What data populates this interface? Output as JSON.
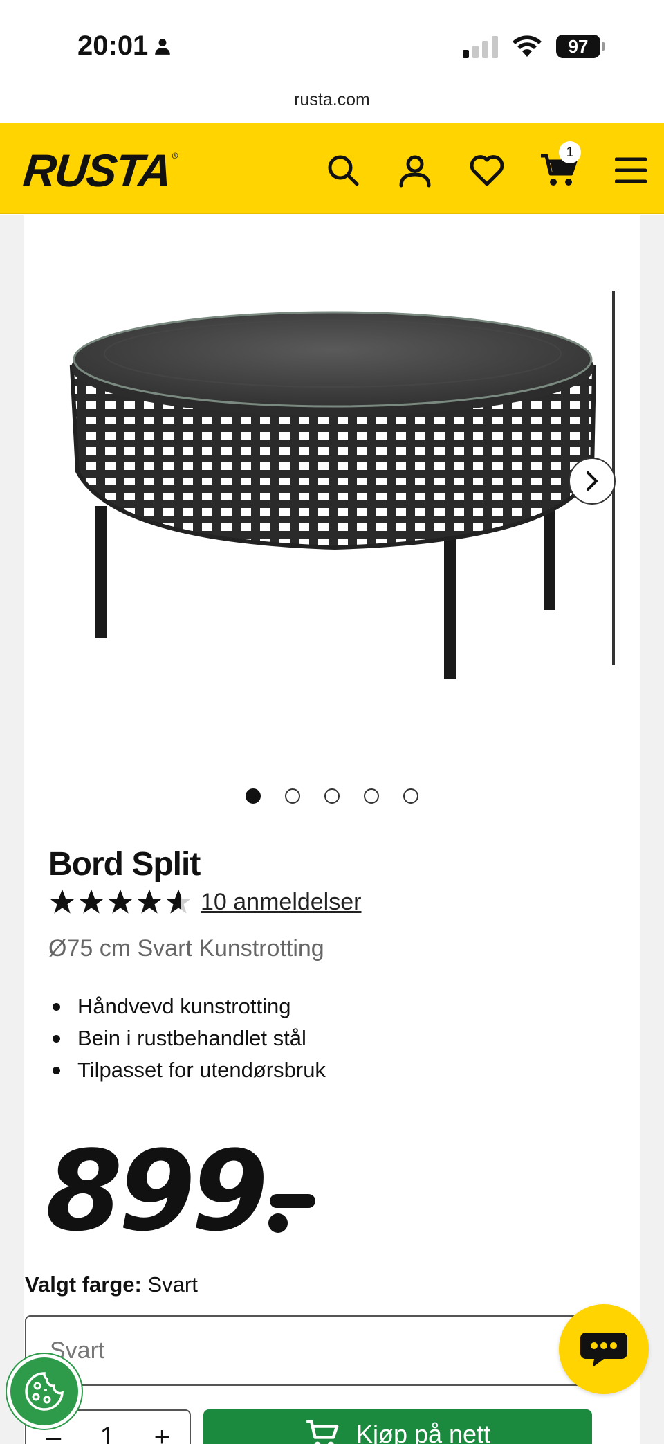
{
  "status_bar": {
    "time": "20:01",
    "battery": "97",
    "url": "rusta.com"
  },
  "header": {
    "logo": "RUSTA",
    "cart_count": "1",
    "icons": [
      "search-icon",
      "user-icon",
      "heart-icon",
      "cart-icon",
      "menu-icon"
    ]
  },
  "gallery": {
    "image_count": 5,
    "active_index": 0
  },
  "product": {
    "title": "Bord Split",
    "rating": 4.5,
    "reviews_label": "10 anmeldelser",
    "subtitle": "Ø75 cm Svart Kunstrotting",
    "features": [
      "Håndvevd kunstrotting",
      "Bein i rustbehandlet stål",
      "Tilpasset for utendørsbruk"
    ],
    "price": "899"
  },
  "color": {
    "label": "Valgt farge:",
    "value": "Svart",
    "select_value": "Svart"
  },
  "purchase": {
    "quantity": "1",
    "minus": "–",
    "plus": "+",
    "buy_label": "Kjøp på nett"
  },
  "colors": {
    "brand_yellow": "#ffd400",
    "buy_green": "#1c8a3e",
    "cookie_green": "#2e9b4b"
  }
}
